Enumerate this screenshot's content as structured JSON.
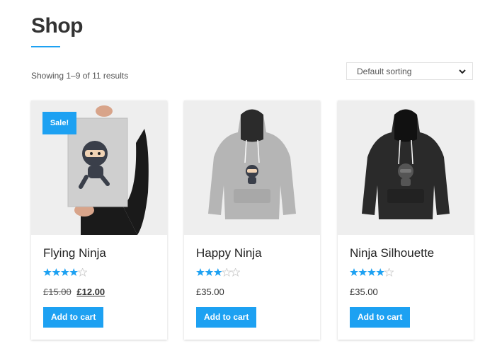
{
  "page": {
    "title": "Shop"
  },
  "results": {
    "text": "Showing 1–9 of 11 results"
  },
  "sorting": {
    "selected": "Default sorting",
    "icon": "chevron-down-icon"
  },
  "colors": {
    "accent": "#1da1f2",
    "star": "#1da1f2",
    "star_empty": "#cccccc"
  },
  "products": [
    {
      "name": "Flying Ninja",
      "rating": 4,
      "max_rating": 5,
      "old_price": "£15.00",
      "price": "£12.00",
      "sale_badge": "Sale!",
      "button": "Add to cart"
    },
    {
      "name": "Happy Ninja",
      "rating": 3,
      "max_rating": 5,
      "price": "£35.00",
      "button": "Add to cart"
    },
    {
      "name": "Ninja Silhouette",
      "rating": 4,
      "max_rating": 5,
      "price": "£35.00",
      "button": "Add to cart"
    }
  ]
}
